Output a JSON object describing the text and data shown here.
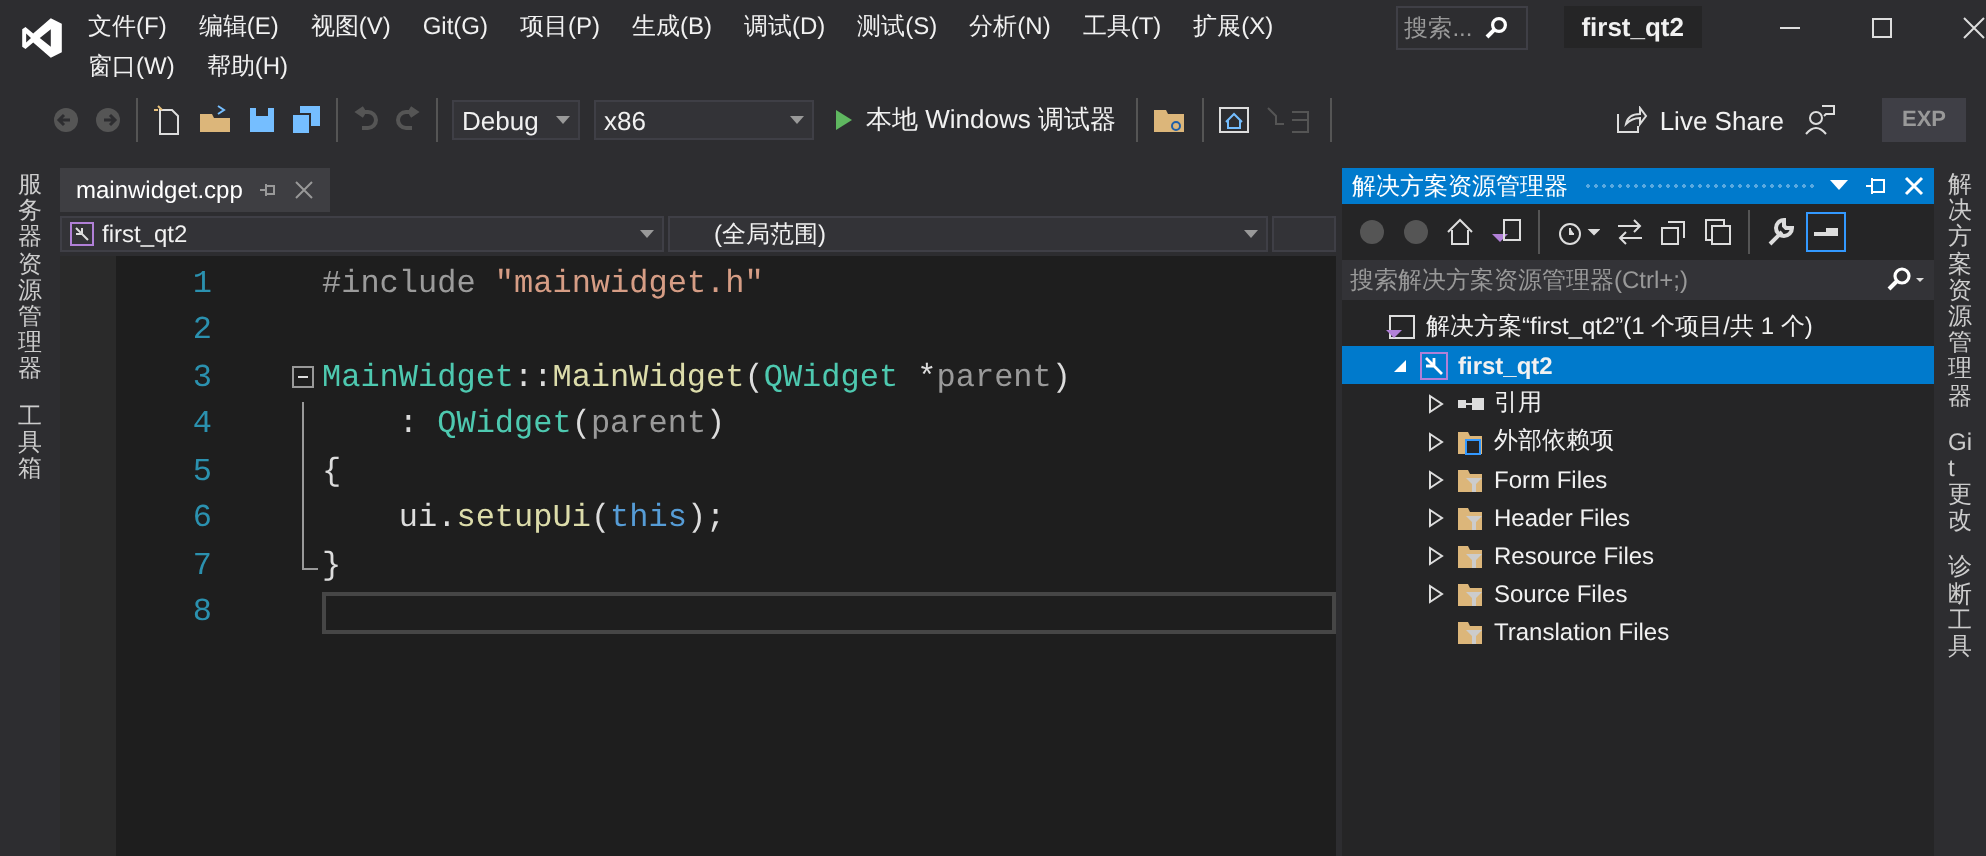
{
  "menu": [
    "文件(F)",
    "编辑(E)",
    "视图(V)",
    "Git(G)",
    "项目(P)",
    "生成(B)",
    "调试(D)",
    "测试(S)",
    "分析(N)",
    "工具(T)",
    "扩展(X)",
    "窗口(W)",
    "帮助(H)"
  ],
  "search": {
    "placeholder": "搜索..."
  },
  "window": {
    "title": "first_qt2"
  },
  "toolbar": {
    "configuration": "Debug",
    "platform": "x86",
    "run": "本地 Windows 调试器",
    "live_share": "Live Share",
    "exp": "EXP"
  },
  "left_strip": [
    "服务器资源管理器",
    "工具箱"
  ],
  "editor": {
    "tabs": [
      {
        "label": "mainwidget.cpp",
        "selected": true
      }
    ],
    "project_scope": "first_qt2",
    "member_scope": "(全局范围)",
    "lines": [
      {
        "number": "1",
        "tokens": [
          {
            "text": "#include ",
            "kind": "directive"
          },
          {
            "text": "\"mainwidget.h\"",
            "kind": "string"
          }
        ]
      },
      {
        "number": "2"
      },
      {
        "number": "3",
        "fold": true,
        "tokens": [
          {
            "text": "MainWidget",
            "kind": "type"
          },
          {
            "text": "::",
            "kind": "plain"
          },
          {
            "text": "MainWidget",
            "kind": "func"
          },
          {
            "text": "(",
            "kind": "plain"
          },
          {
            "text": "QWidget",
            "kind": "type"
          },
          {
            "text": " *",
            "kind": "plain"
          },
          {
            "text": "parent",
            "kind": "param"
          },
          {
            "text": ")",
            "kind": "plain"
          }
        ]
      },
      {
        "number": "4",
        "tokens": [
          {
            "text": "    : ",
            "kind": "plain"
          },
          {
            "text": "QWidget",
            "kind": "type"
          },
          {
            "text": "(",
            "kind": "plain"
          },
          {
            "text": "parent",
            "kind": "param"
          },
          {
            "text": ")",
            "kind": "plain"
          }
        ]
      },
      {
        "number": "5",
        "tokens": [
          {
            "text": "{",
            "kind": "plain"
          }
        ]
      },
      {
        "number": "6",
        "tokens": [
          {
            "text": "    ui",
            "kind": "plain"
          },
          {
            "text": ".",
            "kind": "plain"
          },
          {
            "text": "setupUi",
            "kind": "func"
          },
          {
            "text": "(",
            "kind": "plain"
          },
          {
            "text": "this",
            "kind": "keyword"
          },
          {
            "text": ");",
            "kind": "plain"
          }
        ]
      },
      {
        "number": "7",
        "tokens": [
          {
            "text": "}",
            "kind": "plain"
          }
        ]
      },
      {
        "number": "8",
        "current": true
      }
    ]
  },
  "solution_explorer": {
    "title": "解决方案资源管理器",
    "search": {
      "placeholder": "搜索解决方案资源管理器(Ctrl+;)"
    },
    "tree": [
      {
        "label": "解决方案“first_qt2”(1 个项目/共 1 个)",
        "kind": "solution",
        "selected": false,
        "children": [
          {
            "label": "first_qt2",
            "kind": "project",
            "expanded": true,
            "selected": true,
            "children": [
              {
                "label": "引用",
                "kind": "references",
                "expandable": true,
                "expanded": false,
                "selected": false
              },
              {
                "label": "外部依赖项",
                "kind": "external",
                "expandable": true,
                "expanded": false,
                "selected": false
              },
              {
                "label": "Form Files",
                "kind": "filter",
                "expandable": true,
                "expanded": false,
                "selected": false
              },
              {
                "label": "Header Files",
                "kind": "filter",
                "expandable": true,
                "expanded": false,
                "selected": false
              },
              {
                "label": "Resource Files",
                "kind": "filter",
                "expandable": true,
                "expanded": false,
                "selected": false
              },
              {
                "label": "Source Files",
                "kind": "filter",
                "expandable": true,
                "expanded": false,
                "selected": false
              },
              {
                "label": "Translation Files",
                "kind": "filter",
                "expandable": false,
                "expanded": false,
                "selected": false
              }
            ]
          }
        ]
      }
    ]
  },
  "right_strip": [
    "解决方案资源管理器",
    "Git 更改",
    "诊断工具"
  ]
}
